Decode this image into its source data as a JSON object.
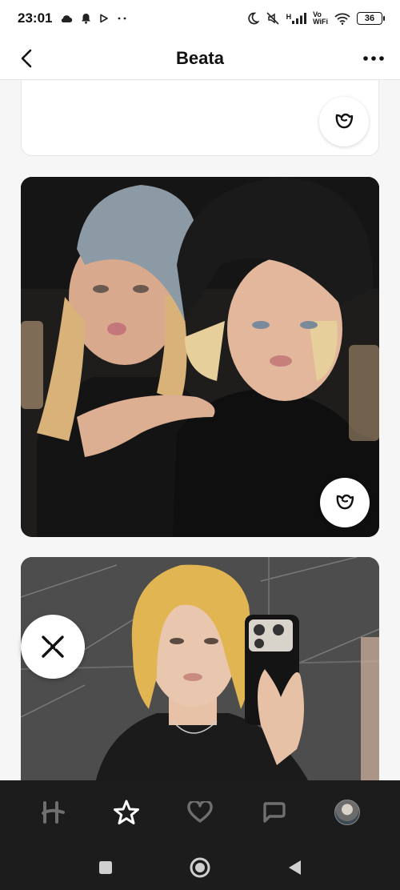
{
  "status_bar": {
    "time": "23:01",
    "left_icons": [
      "cloud-icon",
      "bell-icon",
      "play-icon",
      "more-dots-icon"
    ],
    "right_icons": [
      "moon-icon",
      "mute-icon",
      "signal-icon",
      "wifi-icon"
    ],
    "network_label": "H",
    "vo_wifi_top": "Vo",
    "vo_wifi_bottom": "WiFi",
    "battery": "36"
  },
  "header": {
    "title": "Beata",
    "back_icon": "chevron-left-icon",
    "more_icon": "more-horizontal-icon"
  },
  "cards": [
    {
      "type": "text",
      "action_icon": "rose-icon"
    },
    {
      "type": "photo",
      "description_icon": "photo",
      "action_icon": "rose-icon"
    },
    {
      "type": "photo",
      "description_icon": "photo",
      "action_icon": "none"
    }
  ],
  "skip_button": {
    "icon": "close-x-icon"
  },
  "tab_bar": {
    "items": [
      {
        "name": "discover",
        "icon": "hinge-logo-icon",
        "active": false
      },
      {
        "name": "standouts",
        "icon": "star-icon",
        "active": true
      },
      {
        "name": "likes",
        "icon": "heart-icon",
        "active": false
      },
      {
        "name": "matches",
        "icon": "chat-icon",
        "active": false
      },
      {
        "name": "profile",
        "icon": "avatar",
        "active": false
      }
    ]
  },
  "system_nav": {
    "items": [
      "recents-square-icon",
      "home-circle-icon",
      "back-triangle-icon"
    ]
  },
  "colors": {
    "background": "#f6f6f6",
    "tab_bar": "#1c1c1c",
    "tab_active": "#ffffff",
    "tab_inactive": "#6f6f6f"
  }
}
